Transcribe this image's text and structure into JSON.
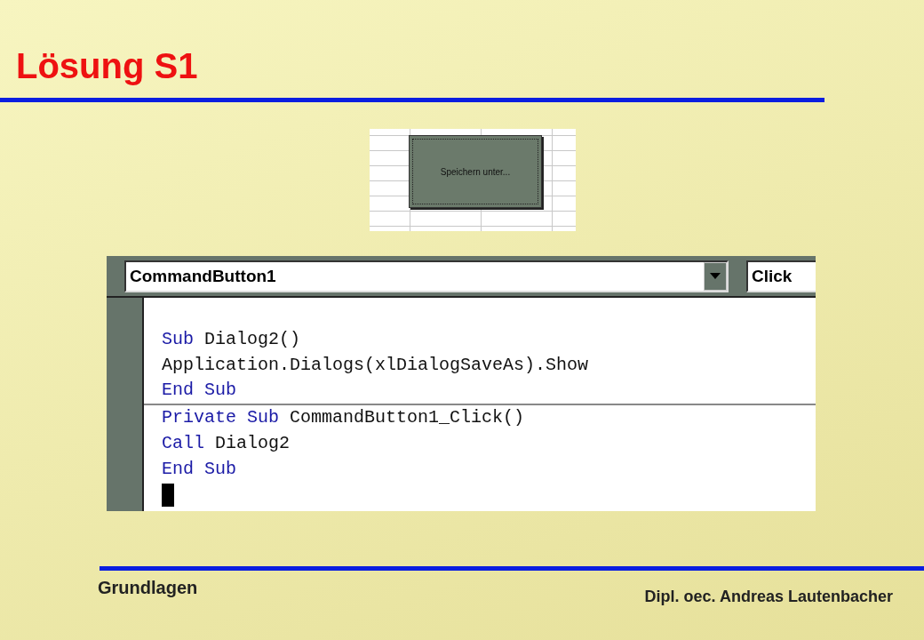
{
  "slide": {
    "title": "Lösung S1",
    "footer_left": "Grundlagen",
    "footer_right": "Dipl. oec. Andreas Lautenbacher"
  },
  "sheet_button": {
    "label": "Speichern unter..."
  },
  "editor": {
    "object_combo": "CommandButton1",
    "procedure_combo": "Click",
    "procedures": [
      {
        "lines": [
          [
            {
              "text": "Sub",
              "kind": "keyword"
            },
            {
              "text": " Dialog2()",
              "kind": "plain"
            }
          ],
          [
            {
              "text": "Application.Dialogs(xlDialogSaveAs).Show",
              "kind": "plain"
            }
          ],
          [
            {
              "text": "End Sub",
              "kind": "keyword"
            }
          ]
        ]
      },
      {
        "lines": [
          [
            {
              "text": "Private Sub",
              "kind": "keyword"
            },
            {
              "text": " CommandButton1_Click()",
              "kind": "plain"
            }
          ],
          [
            {
              "text": "Call",
              "kind": "keyword"
            },
            {
              "text": " Dialog2",
              "kind": "plain"
            }
          ],
          [
            {
              "text": "End Sub",
              "kind": "keyword"
            }
          ]
        ]
      }
    ]
  }
}
